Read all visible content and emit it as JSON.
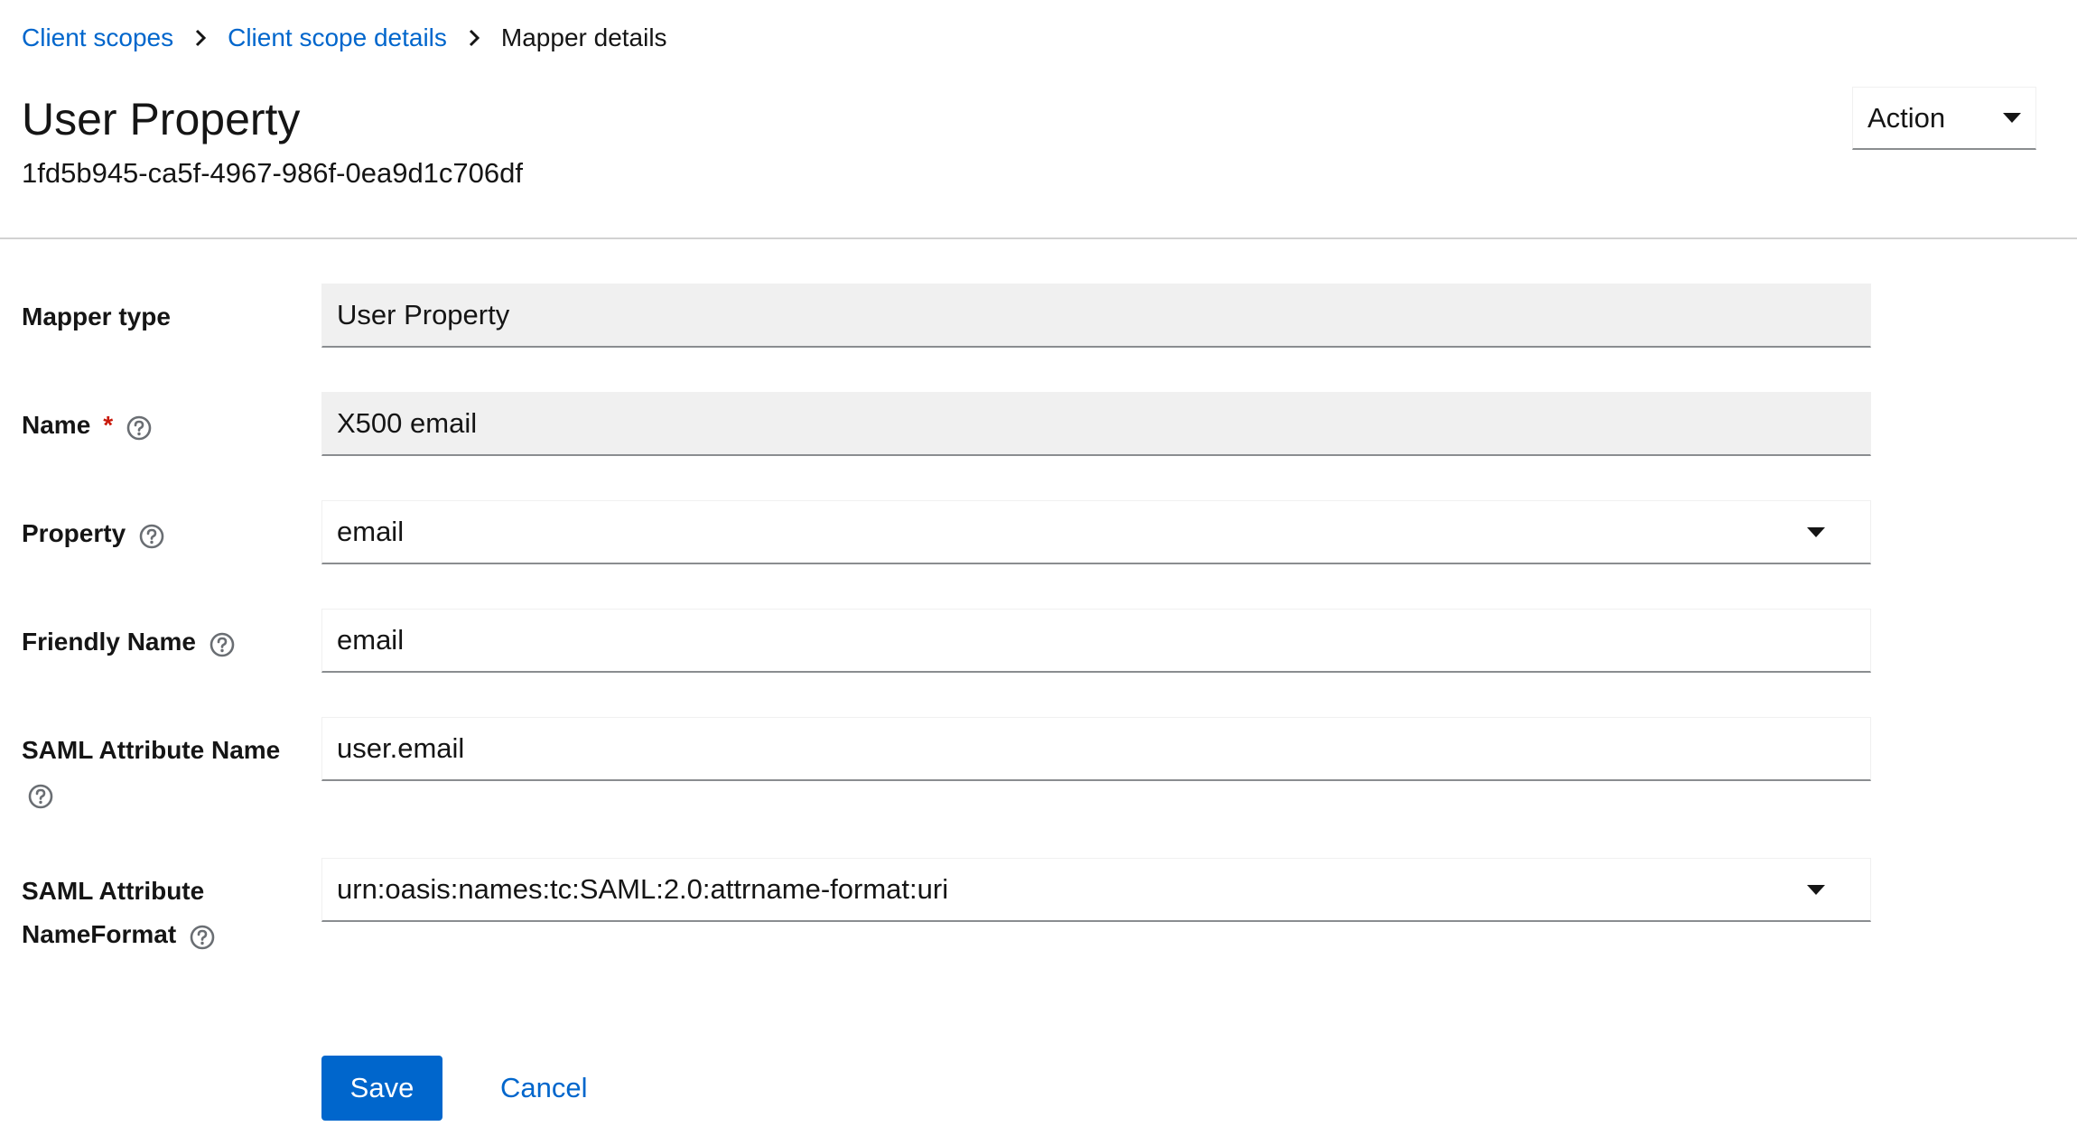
{
  "breadcrumb": {
    "items": [
      {
        "label": "Client scopes"
      },
      {
        "label": "Client scope details"
      },
      {
        "label": "Mapper details"
      }
    ]
  },
  "header": {
    "title": "User Property",
    "id": "1fd5b945-ca5f-4967-986f-0ea9d1c706df",
    "action_label": "Action"
  },
  "form": {
    "mapper_type": {
      "label": "Mapper type",
      "value": "User Property"
    },
    "name": {
      "label": "Name",
      "required_mark": "*",
      "value": "X500 email"
    },
    "property": {
      "label": "Property",
      "value": "email"
    },
    "friendly_name": {
      "label": "Friendly Name",
      "value": "email"
    },
    "saml_attribute_name": {
      "label": "SAML Attribute Name",
      "value": "user.email"
    },
    "saml_attribute_nameformat": {
      "label_line1": "SAML Attribute",
      "label_line2": "NameFormat",
      "value": "urn:oasis:names:tc:SAML:2.0:attrname-format:uri"
    }
  },
  "buttons": {
    "save": "Save",
    "cancel": "Cancel"
  },
  "colors": {
    "link": "#0066cc",
    "primary": "#0066cc",
    "required": "#c9190b",
    "readonly_bg": "#f0f0f0"
  },
  "icons": {
    "help": "question-circle-icon",
    "caret": "caret-down-icon",
    "breadcrumb_separator": "angle-right-icon"
  }
}
